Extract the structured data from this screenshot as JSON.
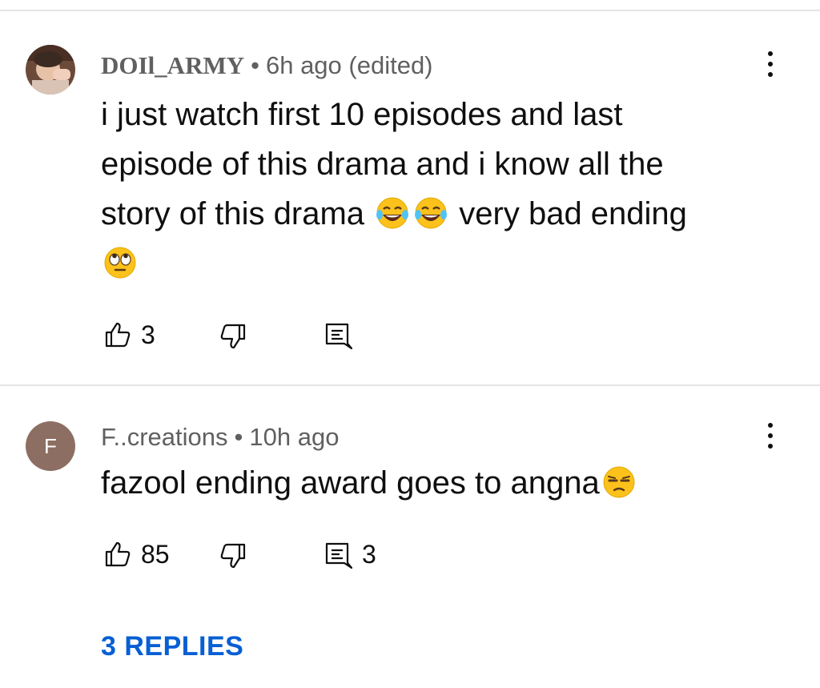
{
  "comments": [
    {
      "author": "DOIl_ARMY",
      "time": "6h ago (edited)",
      "lines": [
        "i just watch first 10 episodes and last",
        "episode of this drama and  i know all the",
        "story of this drama",
        "very bad ending"
      ],
      "emojis": [
        "tears-of-joy",
        "tears-of-joy",
        "eye-roll"
      ],
      "likes": "3",
      "reply_count": "",
      "avatar": "photo"
    },
    {
      "author": "F..creations",
      "time": "10h ago",
      "lines": [
        "fazool ending award goes to angna"
      ],
      "emojis": [
        "unamused"
      ],
      "likes": "85",
      "reply_count": "3",
      "avatar_letter": "F",
      "avatar_color": "#8d6e63"
    }
  ],
  "separator": "•",
  "replies_label": "3 REPLIES",
  "colors": {
    "link": "#065fd4",
    "meta": "#606060",
    "divider": "#e5e5e5"
  }
}
